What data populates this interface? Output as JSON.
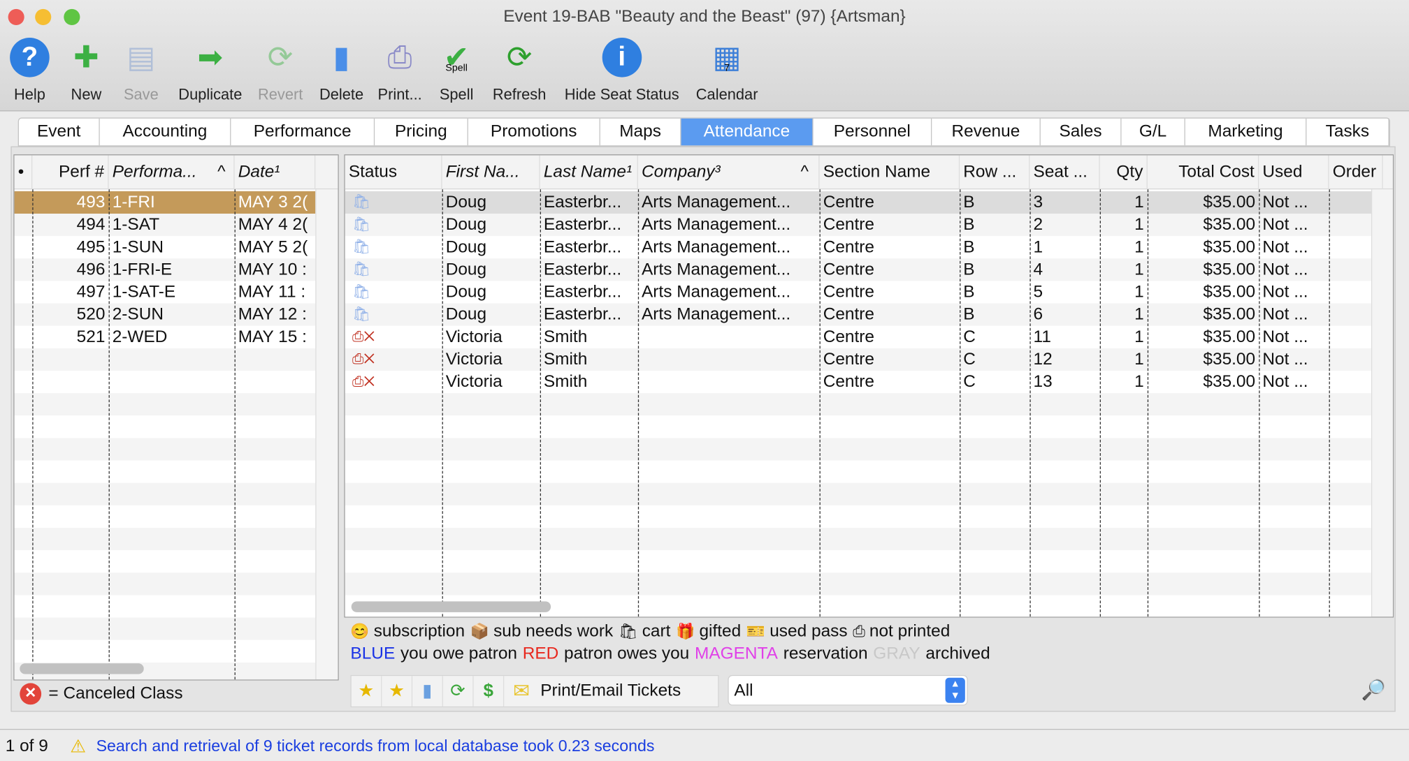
{
  "window": {
    "title": "Event 19-BAB \"Beauty and the Beast\" (97) {Artsman}"
  },
  "toolbar": [
    {
      "label": "Help",
      "icon": "help-icon",
      "enabled": true
    },
    {
      "label": "New",
      "icon": "new-document-icon",
      "enabled": true
    },
    {
      "label": "Save",
      "icon": "save-icon",
      "enabled": false
    },
    {
      "label": "Duplicate",
      "icon": "duplicate-icon",
      "enabled": true
    },
    {
      "label": "Revert",
      "icon": "revert-icon",
      "enabled": false
    },
    {
      "label": "Delete",
      "icon": "trash-icon",
      "enabled": true
    },
    {
      "label": "Print...",
      "icon": "printer-icon",
      "enabled": true
    },
    {
      "label": "Spell",
      "icon": "spell-check-icon",
      "enabled": true,
      "icon_text": "Spell"
    },
    {
      "label": "Refresh",
      "icon": "refresh-icon",
      "enabled": true
    },
    {
      "label": "Hide Seat Status",
      "icon": "info-icon",
      "enabled": true
    },
    {
      "label": "Calendar",
      "icon": "calendar-icon",
      "enabled": true,
      "icon_text": "7"
    }
  ],
  "tabs": [
    "Event",
    "Accounting",
    "Performance",
    "Pricing",
    "Promotions",
    "Maps",
    "Attendance",
    "Personnel",
    "Revenue",
    "Sales",
    "G/L",
    "Marketing",
    "Tasks"
  ],
  "selected_tab": "Attendance",
  "performances": {
    "headers": [
      "•",
      "Perf #",
      "Performa...",
      "Date¹"
    ],
    "sort_indicator": "^",
    "rows": [
      [
        "493",
        "1-FRI",
        "MAY 3 2("
      ],
      [
        "494",
        "1-SAT",
        "MAY 4 2("
      ],
      [
        "495",
        "1-SUN",
        "MAY 5 2("
      ],
      [
        "496",
        "1-FRI-E",
        "MAY 10 :"
      ],
      [
        "497",
        "1-SAT-E",
        "MAY 11 :"
      ],
      [
        "520",
        "2-SUN",
        "MAY 12 :"
      ],
      [
        "521",
        "2-WED",
        "MAY 15 :"
      ]
    ],
    "selected_row": 0,
    "legend": "= Canceled Class"
  },
  "tickets": {
    "headers": [
      "Status",
      "First Na...",
      "Last Name¹",
      "Company³",
      "Section Name",
      "Row ...",
      "Seat ...",
      "Qty",
      "Total Cost",
      "Used",
      "Order I"
    ],
    "sort_indicator": "^",
    "rows": [
      {
        "status": "cart",
        "first": "Doug",
        "last": "Easterbr...",
        "company": "Arts Management...",
        "section": "Centre",
        "row": "B",
        "seat": "3",
        "qty": "1",
        "total": "$35.00",
        "used": "Not ..."
      },
      {
        "status": "cart",
        "first": "Doug",
        "last": "Easterbr...",
        "company": "Arts Management...",
        "section": "Centre",
        "row": "B",
        "seat": "2",
        "qty": "1",
        "total": "$35.00",
        "used": "Not ..."
      },
      {
        "status": "cart",
        "first": "Doug",
        "last": "Easterbr...",
        "company": "Arts Management...",
        "section": "Centre",
        "row": "B",
        "seat": "1",
        "qty": "1",
        "total": "$35.00",
        "used": "Not ..."
      },
      {
        "status": "cart",
        "first": "Doug",
        "last": "Easterbr...",
        "company": "Arts Management...",
        "section": "Centre",
        "row": "B",
        "seat": "4",
        "qty": "1",
        "total": "$35.00",
        "used": "Not ..."
      },
      {
        "status": "cart",
        "first": "Doug",
        "last": "Easterbr...",
        "company": "Arts Management...",
        "section": "Centre",
        "row": "B",
        "seat": "5",
        "qty": "1",
        "total": "$35.00",
        "used": "Not ..."
      },
      {
        "status": "cart",
        "first": "Doug",
        "last": "Easterbr...",
        "company": "Arts Management...",
        "section": "Centre",
        "row": "B",
        "seat": "6",
        "qty": "1",
        "total": "$35.00",
        "used": "Not ..."
      },
      {
        "status": "not-printed",
        "first": "Victoria",
        "last": "Smith",
        "company": "",
        "section": "Centre",
        "row": "C",
        "seat": "11",
        "qty": "1",
        "total": "$35.00",
        "used": "Not ..."
      },
      {
        "status": "not-printed",
        "first": "Victoria",
        "last": "Smith",
        "company": "",
        "section": "Centre",
        "row": "C",
        "seat": "12",
        "qty": "1",
        "total": "$35.00",
        "used": "Not ..."
      },
      {
        "status": "not-printed",
        "first": "Victoria",
        "last": "Smith",
        "company": "",
        "section": "Centre",
        "row": "C",
        "seat": "13",
        "qty": "1",
        "total": "$35.00",
        "used": "Not ..."
      }
    ]
  },
  "legend": {
    "icons": [
      "subscription",
      "sub needs work",
      "cart",
      "gifted",
      "used pass",
      "not printed"
    ],
    "colors": [
      {
        "word": "BLUE",
        "text": "you owe patron",
        "color": "#1a33e6"
      },
      {
        "word": "RED",
        "text": "patron owes you",
        "color": "#e8281e"
      },
      {
        "word": "MAGENTA",
        "text": "reservation",
        "color": "#e040e8"
      },
      {
        "word": "GRAY",
        "text": "archived",
        "color": "#c8c8c8"
      }
    ]
  },
  "bottom_bar": {
    "print_label": "Print/Email Tickets",
    "filter_value": "All"
  },
  "status_bar": {
    "record": "1 of 9",
    "message": "Search and retrieval of 9 ticket records from local database took 0.23 seconds"
  }
}
